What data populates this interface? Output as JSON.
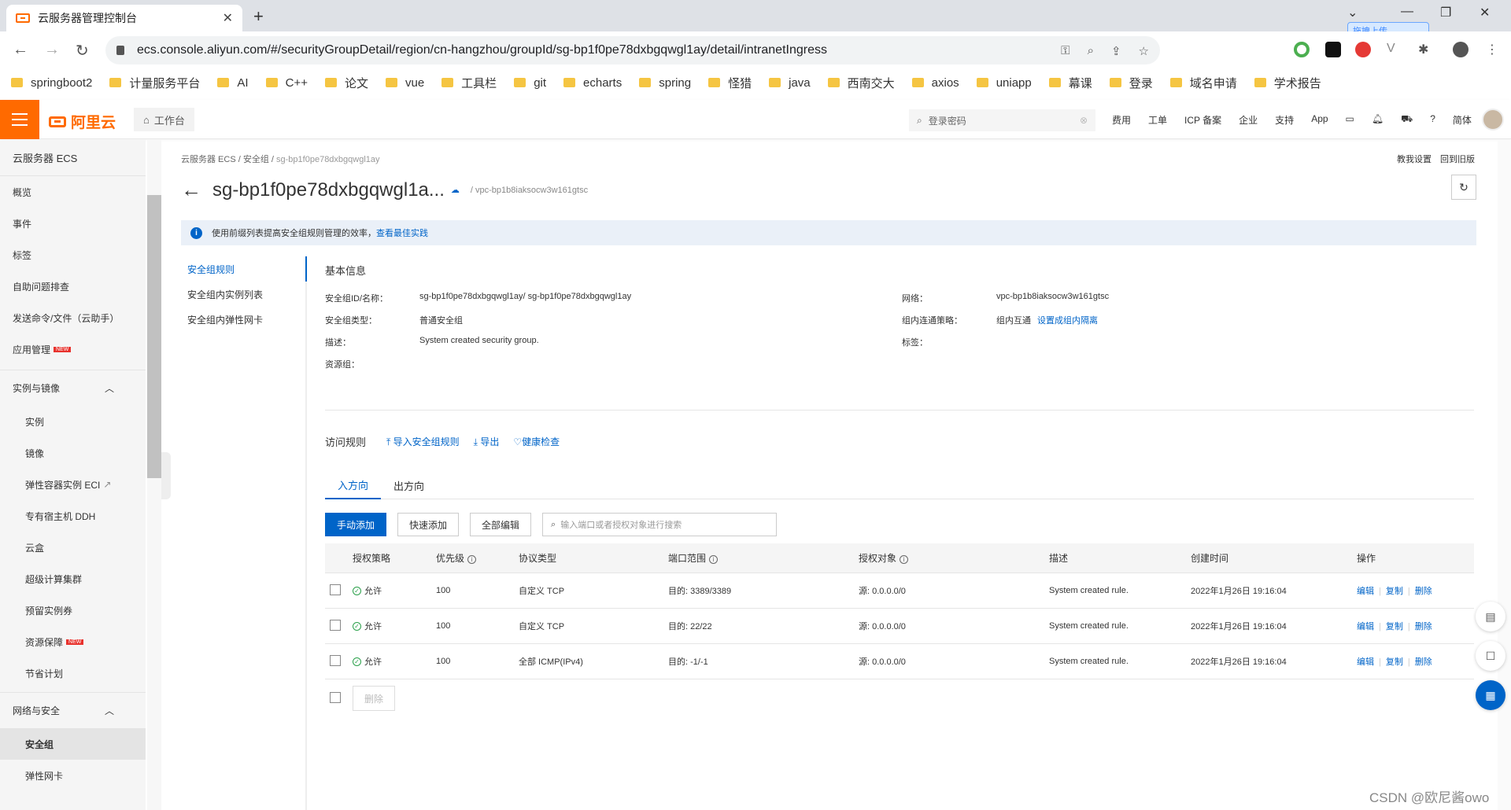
{
  "browser": {
    "tab_title": "云服务器管理控制台",
    "url": "ecs.console.aliyun.com/#/securityGroupDetail/region/cn-hangzhou/groupId/sg-bp1f0pe78dxbgqwgl1ay/detail/intranetIngress",
    "upload_badge": "拖拽上传",
    "bookmarks": [
      "springboot2",
      "计量服务平台",
      "AI",
      "C++",
      "论文",
      "vue",
      "工具栏",
      "git",
      "echarts",
      "spring",
      "怪猎",
      "java",
      "西南交大",
      "axios",
      "uniapp",
      "幕课",
      "登录",
      "域名申请",
      "学术报告"
    ]
  },
  "header": {
    "logo": "阿里云",
    "workbench": "工作台",
    "search_placeholder": "登录密码",
    "links": [
      "费用",
      "工单",
      "ICP 备案",
      "企业",
      "支持",
      "App"
    ],
    "lang": "简体"
  },
  "sidebar": {
    "title": "云服务器 ECS",
    "top_items": [
      "概览",
      "事件",
      "标签",
      "自助问题排查",
      "发送命令/文件（云助手）",
      "应用管理"
    ],
    "group1": "实例与镜像",
    "group1_items": [
      "实例",
      "镜像",
      "弹性容器实例 ECI",
      "专有宿主机 DDH",
      "云盒",
      "超级计算集群",
      "预留实例券",
      "资源保障",
      "节省计划"
    ],
    "group2": "网络与安全",
    "group2_items": [
      "安全组",
      "弹性网卡"
    ],
    "new_label": "NEW"
  },
  "main": {
    "breadcrumb": [
      "云服务器 ECS",
      "安全组",
      "sg-bp1f0pe78dxbgqwgl1ay"
    ],
    "top_links": "教我设置　回到旧版",
    "title": "sg-bp1f0pe78dxbgqwgl1a...",
    "vpc_sub": "/ vpc-bp1b8iaksocw3w161gtsc",
    "notice_text": "使用前缀列表提高安全组规则管理的效率，",
    "notice_link": "查看最佳实践",
    "subnav": [
      "安全组规则",
      "安全组内实例列表",
      "安全组内弹性网卡"
    ],
    "basic_title": "基本信息",
    "info": {
      "id_label": "安全组ID/名称：",
      "id_value": "sg-bp1f0pe78dxbgqwgl1ay/ sg-bp1f0pe78dxbgqwgl1ay",
      "type_label": "安全组类型：",
      "type_value": "普通安全组",
      "desc_label": "描述：",
      "desc_value": "System created security group.",
      "rg_label": "资源组：",
      "net_label": "网络：",
      "net_value": "vpc-bp1b8iaksocw3w161gtsc",
      "policy_label": "组内连通策略：",
      "policy_value": "组内互通",
      "policy_link": "设置成组内隔离",
      "tag_label": "标签："
    },
    "access_title": "访问规则",
    "import_link": "导入安全组规则",
    "export_link": "导出",
    "health_link": "健康检查",
    "tabs": [
      "入方向",
      "出方向"
    ],
    "buttons": {
      "manual_add": "手动添加",
      "quick_add": "快速添加",
      "bulk_edit": "全部编辑",
      "delete": "删除"
    },
    "search_placeholder": "输入端口或者授权对象进行搜索",
    "columns": [
      "授权策略",
      "优先级",
      "协议类型",
      "端口范围",
      "授权对象",
      "描述",
      "创建时间",
      "操作"
    ],
    "rows": [
      {
        "policy": "允许",
        "priority": "100",
        "protocol": "自定义 TCP",
        "port": "目的: 3389/3389",
        "source": "源: 0.0.0.0/0",
        "desc": "System created rule.",
        "time": "2022年1月26日 19:16:04"
      },
      {
        "policy": "允许",
        "priority": "100",
        "protocol": "自定义 TCP",
        "port": "目的: 22/22",
        "source": "源: 0.0.0.0/0",
        "desc": "System created rule.",
        "time": "2022年1月26日 19:16:04"
      },
      {
        "policy": "允许",
        "priority": "100",
        "protocol": "全部 ICMP(IPv4)",
        "port": "目的: -1/-1",
        "source": "源: 0.0.0.0/0",
        "desc": "System created rule.",
        "time": "2022年1月26日 19:16:04"
      }
    ],
    "ops": [
      "编辑",
      "复制",
      "删除"
    ]
  },
  "watermark": "CSDN @欧尼酱owo"
}
